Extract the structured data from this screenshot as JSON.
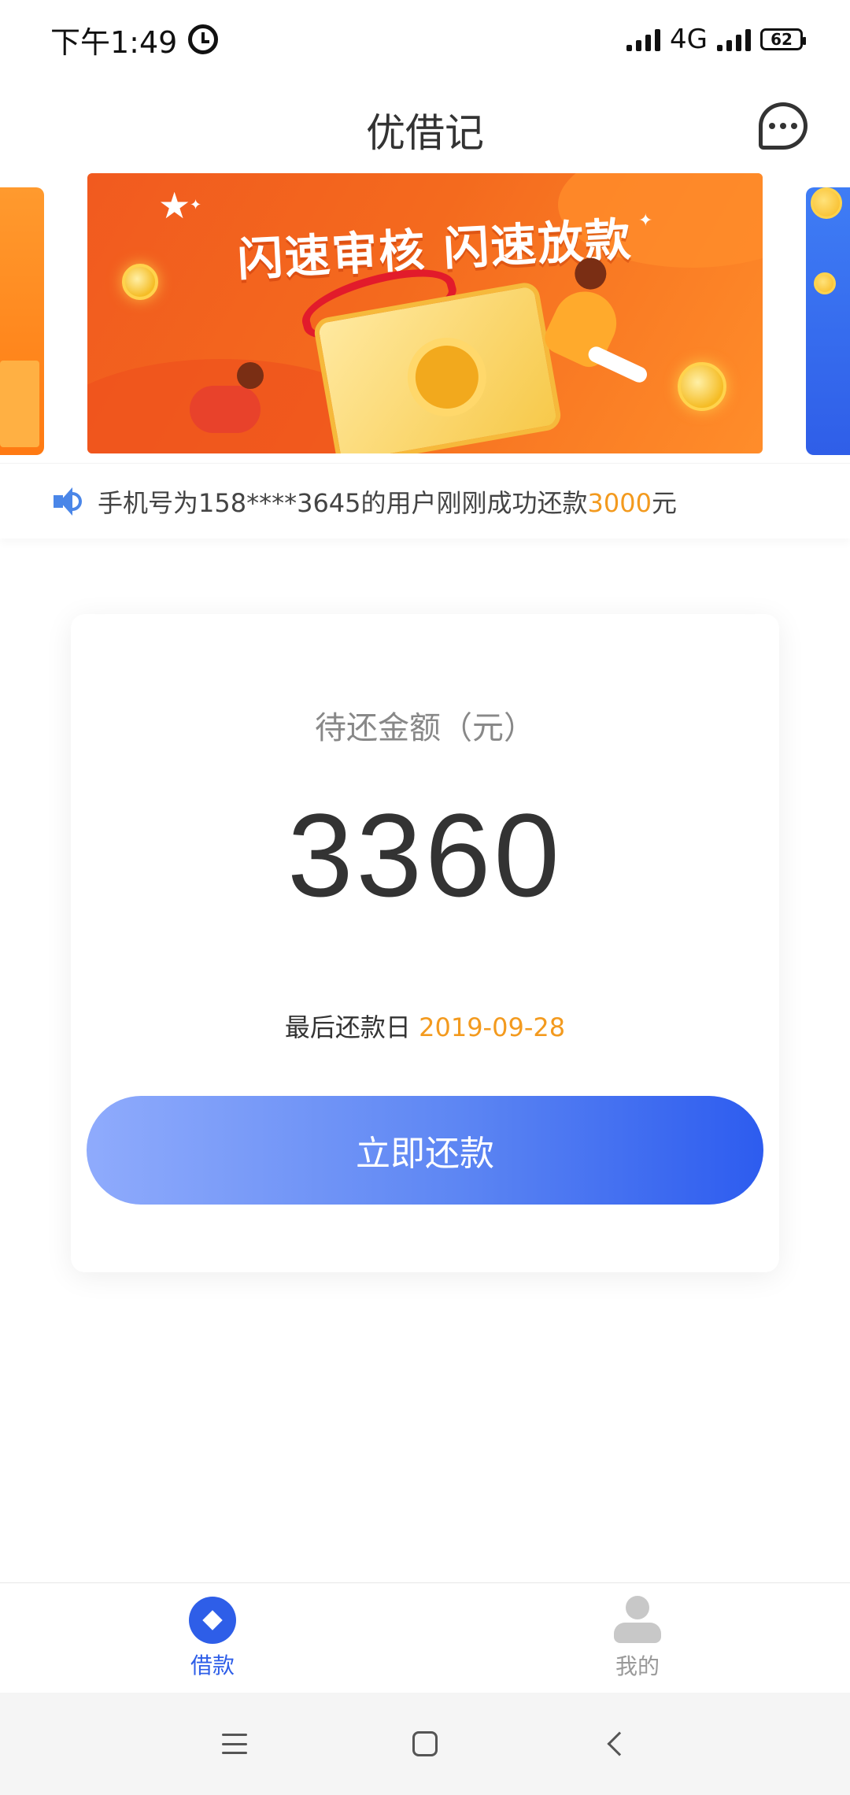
{
  "status_bar": {
    "time": "下午1:49",
    "network": "4G",
    "battery": "62"
  },
  "header": {
    "title": "优借记"
  },
  "banner": {
    "headline": "闪速审核 闪速放款"
  },
  "notice": {
    "prefix": "手机号为158****3645的用户刚刚成功还款",
    "amount": "3000",
    "suffix": "元"
  },
  "card": {
    "label": "待还金额（元）",
    "amount": "3360",
    "due_label": "最后还款日",
    "due_date": "2019-09-28",
    "button_label": "立即还款"
  },
  "tabs": [
    {
      "label": "借款",
      "active": true
    },
    {
      "label": "我的",
      "active": false
    }
  ],
  "colors": {
    "accent_blue": "#2e5ee8",
    "highlight_orange": "#f39a1e",
    "banner_orange": "#f15a1f"
  }
}
